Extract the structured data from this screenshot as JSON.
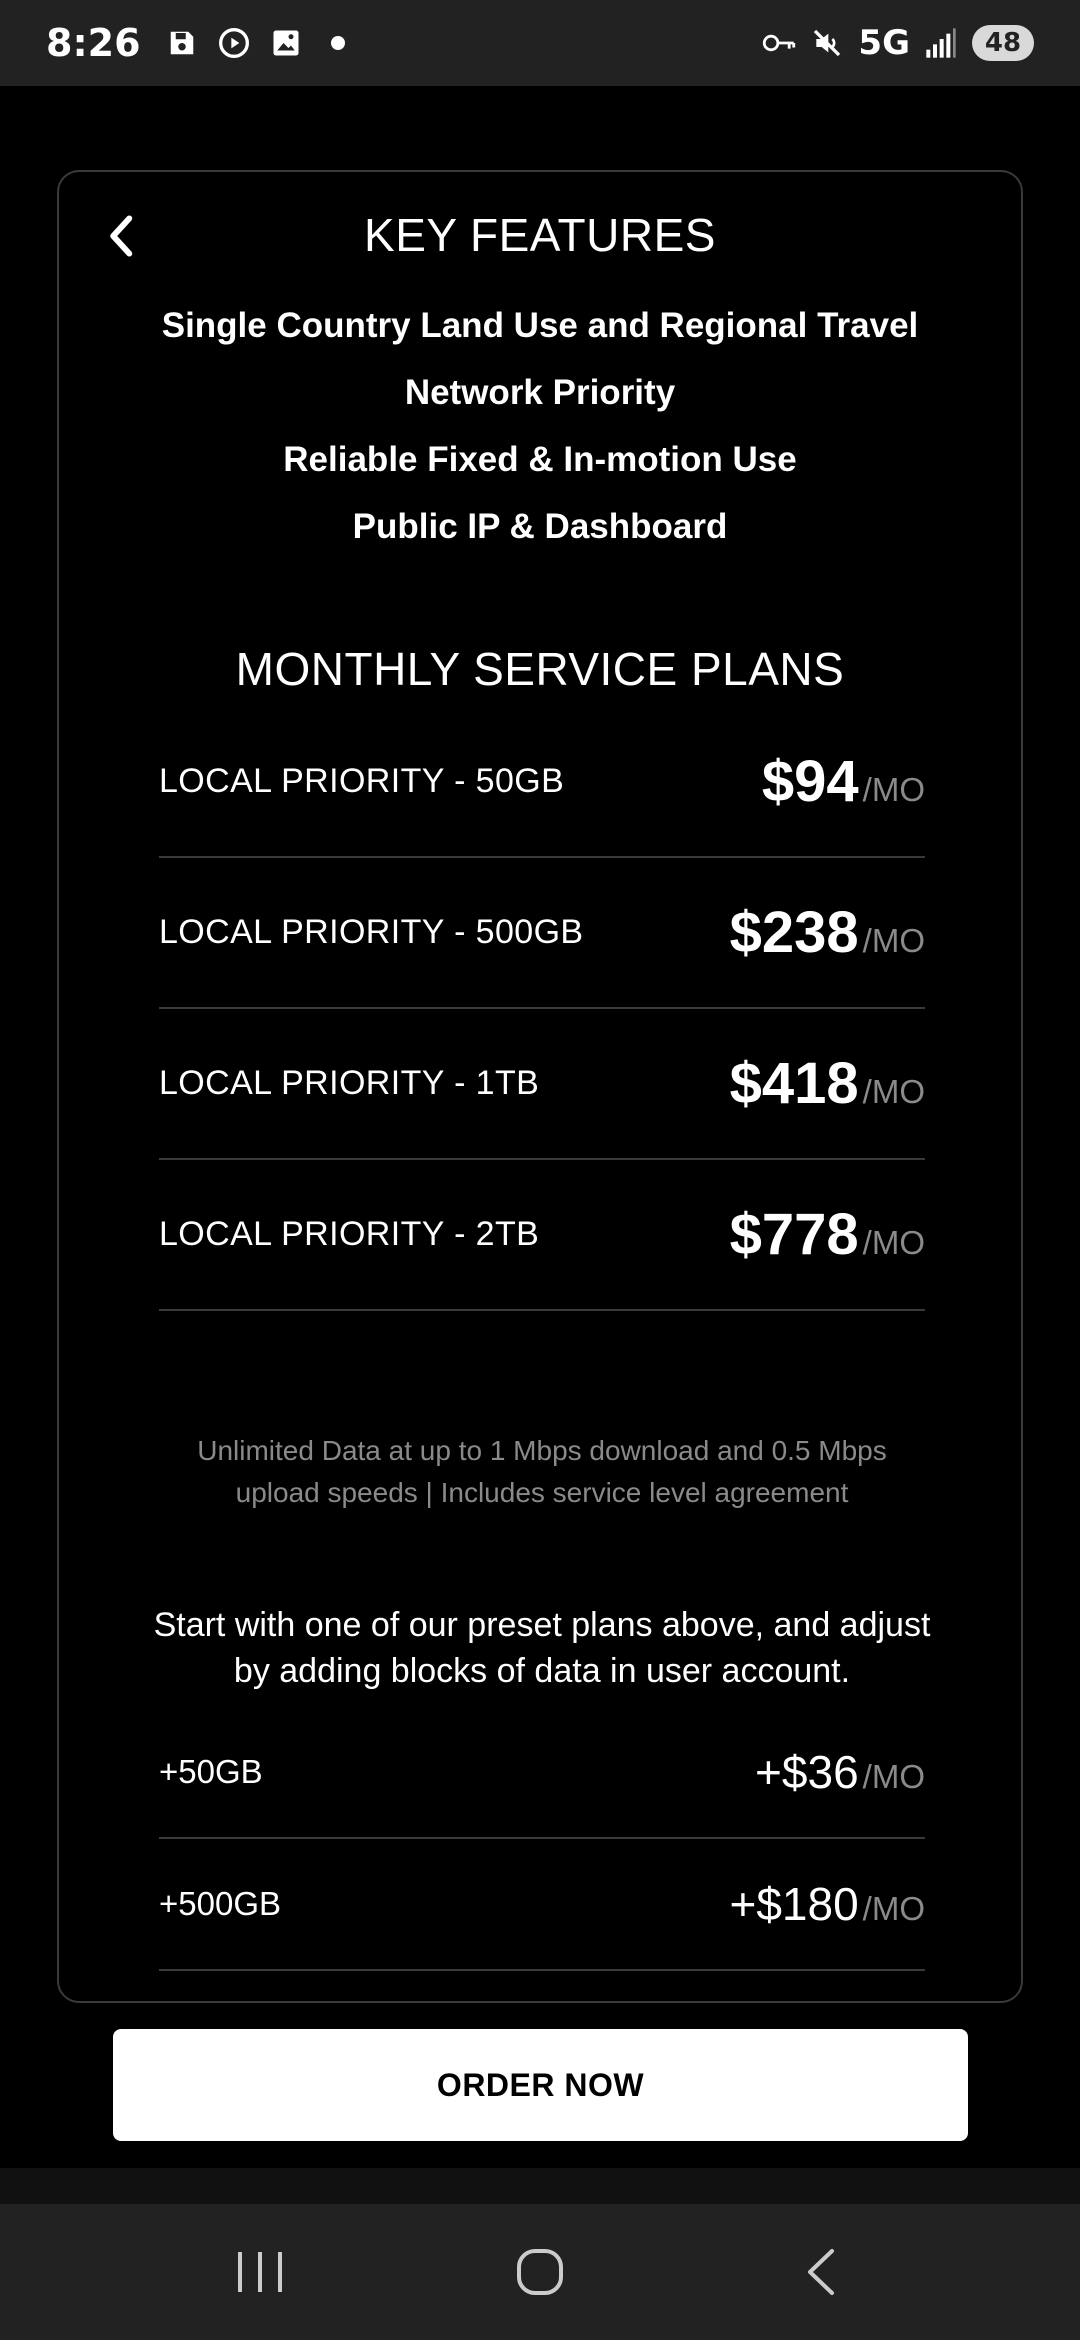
{
  "status_bar": {
    "time": "8:26",
    "left_icons": [
      "save-icon",
      "play-circle-icon",
      "image-icon",
      "dot-icon"
    ],
    "right_icons": [
      "vpn-key-icon",
      "mute-icon",
      "signal-icon"
    ],
    "network": "5G",
    "battery": "48"
  },
  "header": {
    "title": "KEY FEATURES",
    "back_icon": "chevron-left-icon"
  },
  "features": [
    "Single Country Land Use and Regional Travel",
    "Network Priority",
    "Reliable Fixed & In-motion Use",
    "Public IP & Dashboard"
  ],
  "plans_section": {
    "title": "MONTHLY SERVICE PLANS",
    "per_month": "/MO",
    "plans": [
      {
        "name": "LOCAL PRIORITY - 50GB",
        "price": "$94"
      },
      {
        "name": "LOCAL PRIORITY - 500GB",
        "price": "$238"
      },
      {
        "name": "LOCAL PRIORITY - 1TB",
        "price": "$418"
      },
      {
        "name": "LOCAL PRIORITY - 2TB",
        "price": "$778"
      }
    ],
    "note_line1": "Unlimited Data at up to 1 Mbps download and 0.5 Mbps",
    "note_line2": "upload speeds | Includes service level agreement"
  },
  "addons_section": {
    "intro_line1": "Start with one of our preset plans above, and adjust",
    "intro_line2": "by adding blocks of data in user account.",
    "addons": [
      {
        "name": "+50GB",
        "price": "+$36"
      },
      {
        "name": "+500GB",
        "price": "+$180"
      }
    ]
  },
  "order_button": {
    "label": "ORDER NOW"
  },
  "nav_bar": {
    "icons": [
      "recent-apps-icon",
      "home-icon",
      "back-icon"
    ]
  },
  "colors": {
    "background": "#000000",
    "status_bar": "#222222",
    "divider": "#3a3a3a",
    "muted_text": "#8a8a8a",
    "button_bg": "#ffffff"
  }
}
